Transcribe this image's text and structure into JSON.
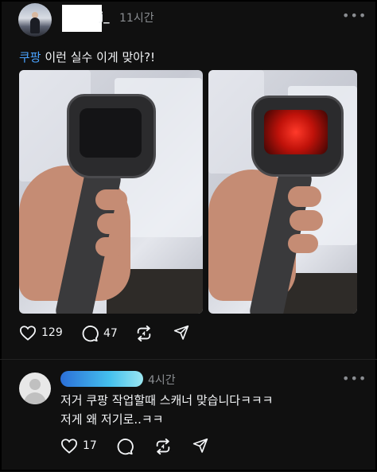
{
  "post": {
    "username_suffix": "j_",
    "time": "11시간",
    "more": "•••",
    "caption_highlight": "쿠팡",
    "caption_rest": " 이런 실수 이게 맞아?!",
    "likes": "129",
    "comments": "47"
  },
  "reply": {
    "time": "4시간",
    "more": "•••",
    "line1": "저거 쿠팡 작업할때 스캐너 맞습니다ㅋㅋㅋ",
    "line2": "저게 왜 저기로..ㅋㅋ",
    "likes": "17"
  },
  "colors": {
    "background": "#101010",
    "link": "#4aa3ff",
    "muted": "#8a8d91",
    "laser": "#ff3a2a"
  },
  "icons": [
    "heart-icon",
    "comment-icon",
    "repost-icon",
    "share-icon",
    "more-icon"
  ]
}
